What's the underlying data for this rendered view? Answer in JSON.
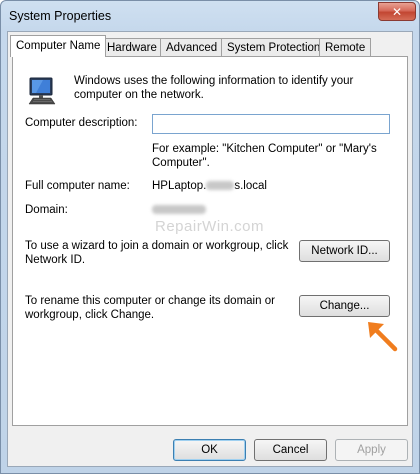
{
  "window": {
    "title": "System Properties",
    "close_glyph": "✕"
  },
  "tabs": [
    {
      "label": "Computer Name",
      "active": true
    },
    {
      "label": "Hardware",
      "active": false
    },
    {
      "label": "Advanced",
      "active": false
    },
    {
      "label": "System Protection",
      "active": false
    },
    {
      "label": "Remote",
      "active": false
    }
  ],
  "computer_name": {
    "intro": "Windows uses the following information to identify your computer on the network.",
    "description_label": "Computer description:",
    "description_value": "",
    "description_hint": "For example: \"Kitchen Computer\" or \"Mary's Computer\".",
    "full_name_label": "Full computer name:",
    "full_name_prefix": "HPLaptop.",
    "full_name_suffix": "s.local",
    "domain_label": "Domain:",
    "network_id_text": "To use a wizard to join a domain or workgroup, click Network ID.",
    "network_id_button": "Network ID...",
    "rename_text": "To rename this computer or change its domain or workgroup, click Change.",
    "change_button": "Change..."
  },
  "watermark": "RepairWin.com",
  "footer": {
    "ok": "OK",
    "cancel": "Cancel",
    "apply": "Apply"
  },
  "icons": {
    "computer": "computer-monitor-icon",
    "pointer": "arrow-pointer-icon",
    "close": "close-icon"
  },
  "colors": {
    "accent_arrow": "#f07d1e",
    "close_red": "#c24632",
    "title_bar": "#c5d8ec"
  }
}
